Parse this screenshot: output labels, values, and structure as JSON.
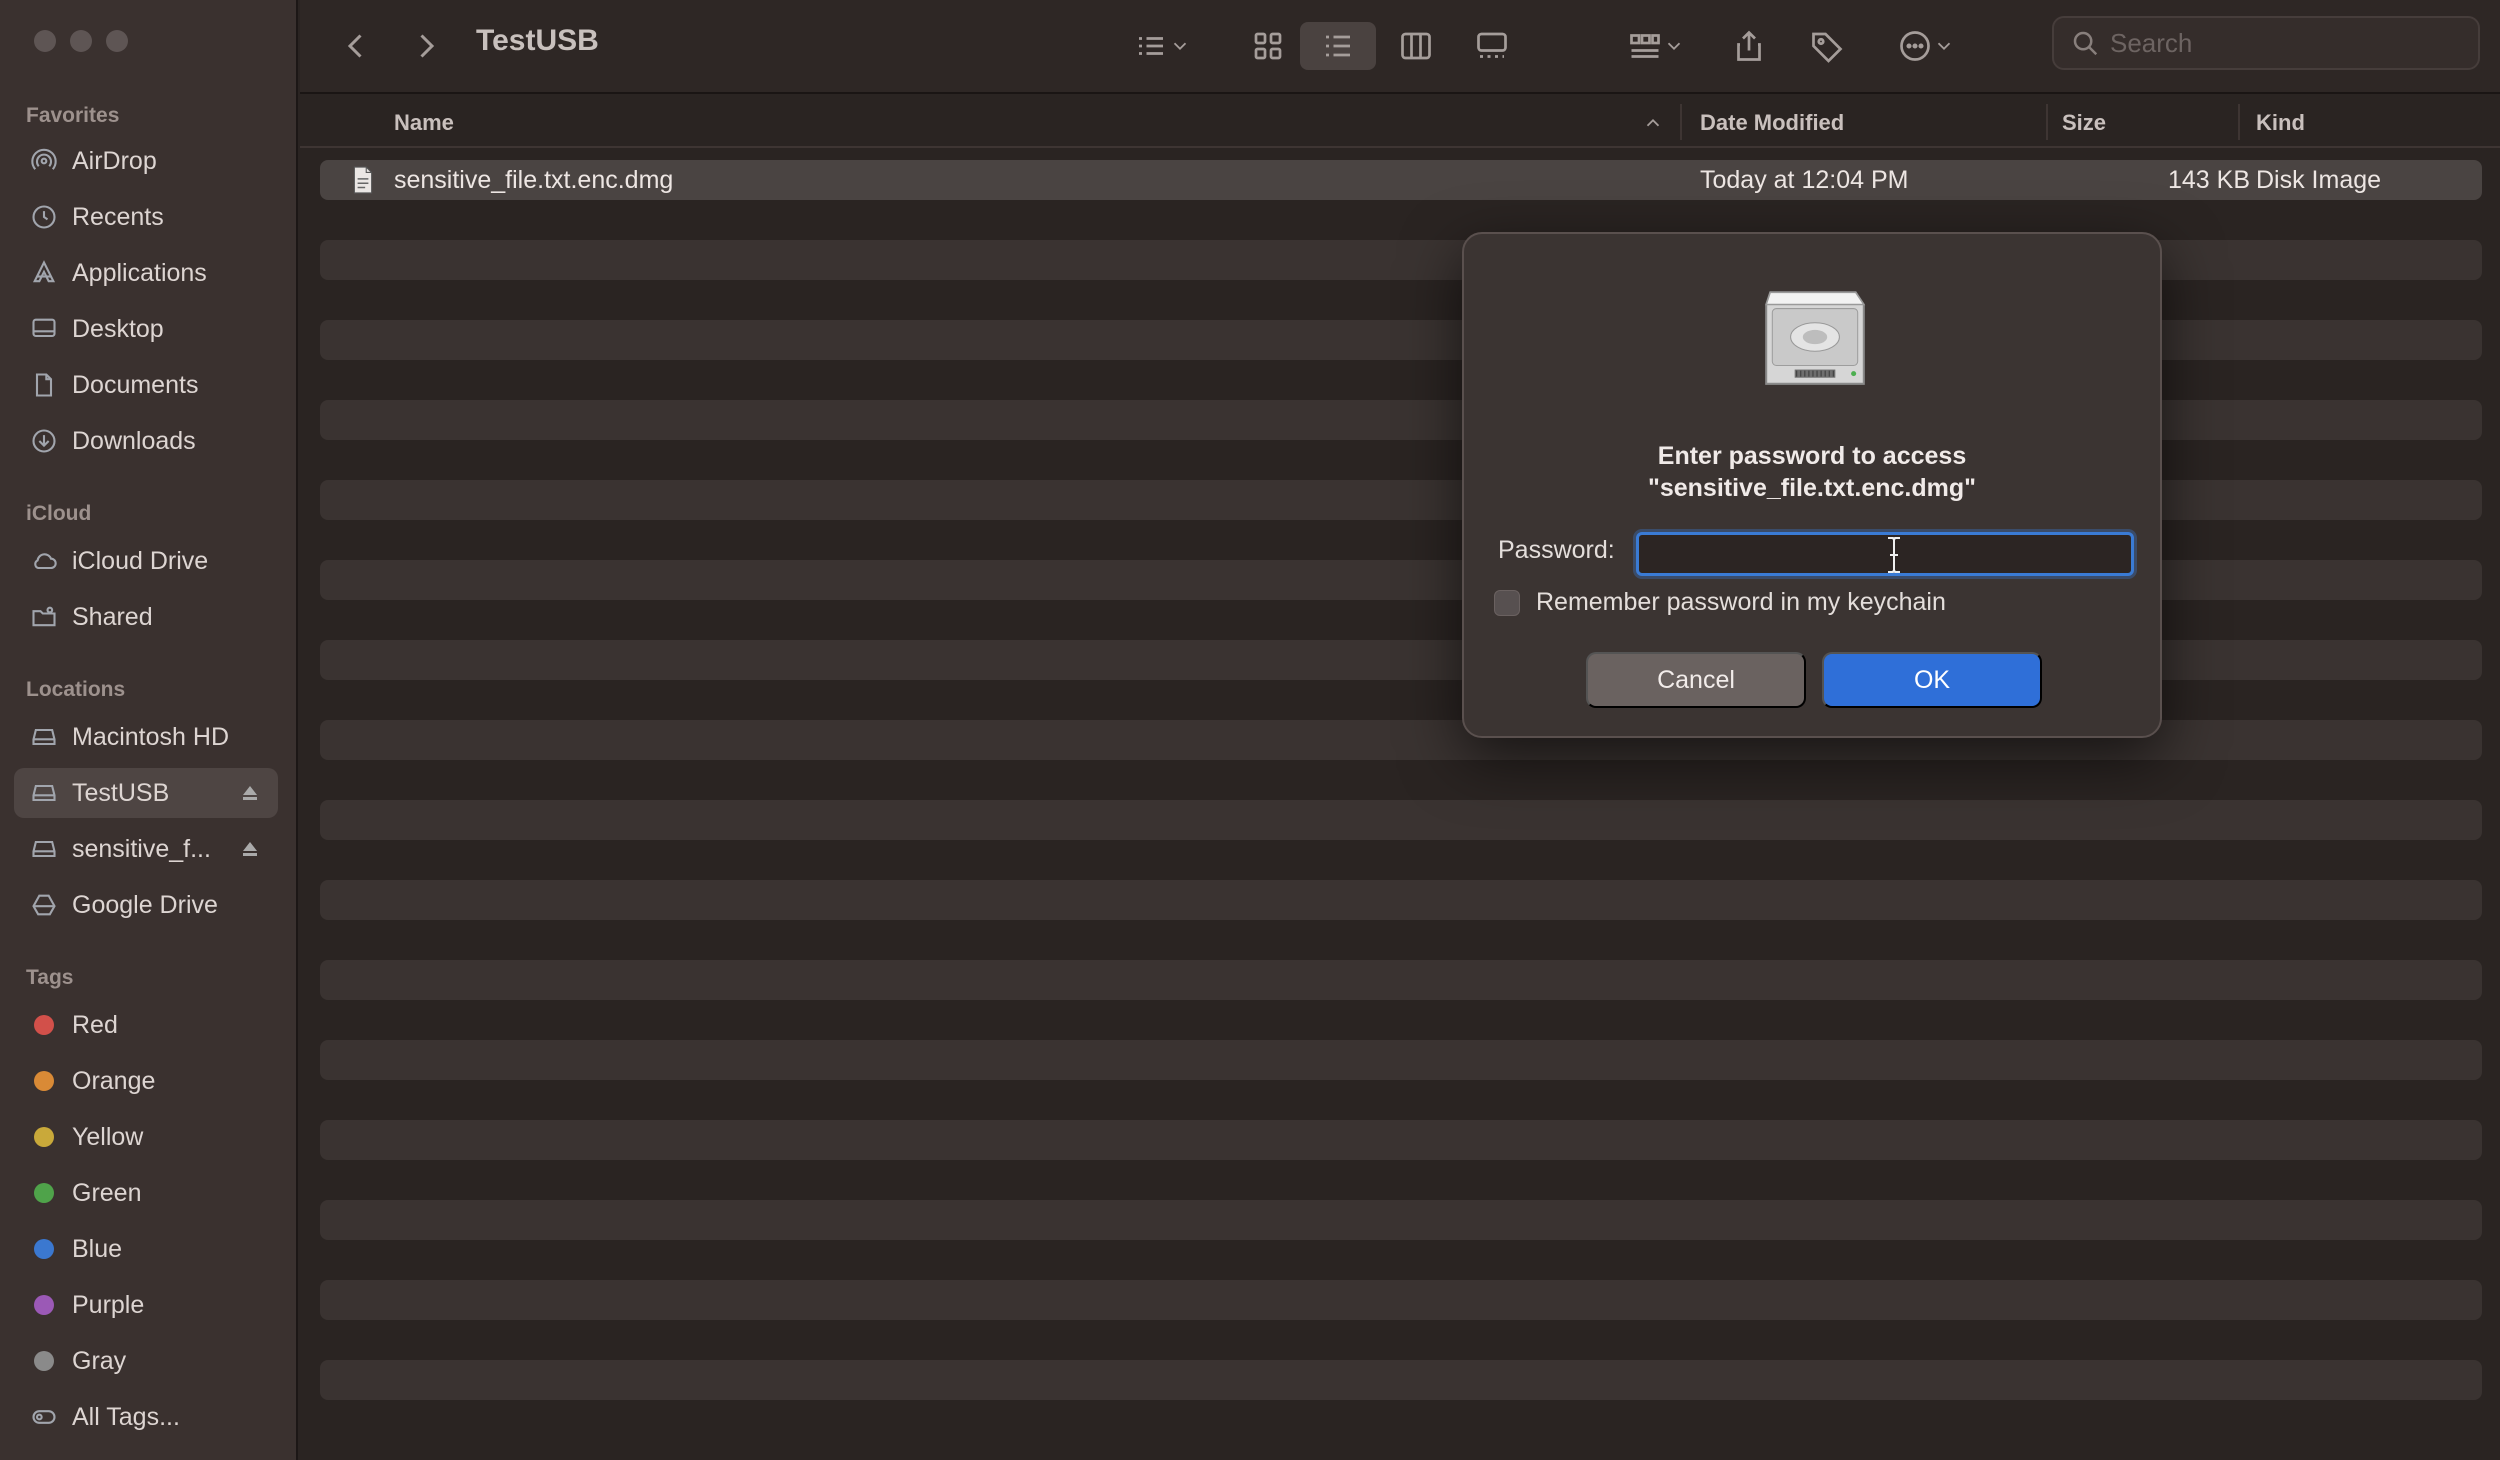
{
  "window": {
    "title": "TestUSB"
  },
  "sidebar": {
    "sections": [
      {
        "label": "Favorites",
        "items": [
          {
            "label": "AirDrop",
            "icon": "airdrop-icon"
          },
          {
            "label": "Recents",
            "icon": "clock-icon"
          },
          {
            "label": "Applications",
            "icon": "applications-icon"
          },
          {
            "label": "Desktop",
            "icon": "desktop-icon"
          },
          {
            "label": "Documents",
            "icon": "document-icon"
          },
          {
            "label": "Downloads",
            "icon": "download-icon"
          }
        ]
      },
      {
        "label": "iCloud",
        "items": [
          {
            "label": "iCloud Drive",
            "icon": "cloud-icon"
          },
          {
            "label": "Shared",
            "icon": "shared-folder-icon"
          }
        ]
      },
      {
        "label": "Locations",
        "items": [
          {
            "label": "Macintosh HD",
            "icon": "drive-icon"
          },
          {
            "label": "TestUSB",
            "icon": "drive-icon",
            "selected": true
          },
          {
            "label": "sensitive_f...",
            "icon": "drive-icon"
          },
          {
            "label": "Google Drive",
            "icon": "google-drive-icon"
          }
        ]
      },
      {
        "label": "Tags",
        "items": [
          {
            "label": "Red",
            "color": "#d2504a"
          },
          {
            "label": "Orange",
            "color": "#d98a36"
          },
          {
            "label": "Yellow",
            "color": "#c9a93a"
          },
          {
            "label": "Green",
            "color": "#4fa34a"
          },
          {
            "label": "Blue",
            "color": "#3b78d0"
          },
          {
            "label": "Purple",
            "color": "#9b59b6"
          },
          {
            "label": "Gray",
            "color": "#8a8a8a"
          },
          {
            "label": "All Tags...",
            "icon": "all-tags-icon"
          }
        ]
      }
    ]
  },
  "toolbar": {
    "title": "TestUSB",
    "search_placeholder": "Search"
  },
  "columns": {
    "name": "Name",
    "date": "Date Modified",
    "size": "Size",
    "kind": "Kind"
  },
  "files": [
    {
      "name": "sensitive_file.txt.enc.dmg",
      "date": "Today at 12:04 PM",
      "size": "143 KB",
      "kind": "Disk Image"
    }
  ],
  "dialog": {
    "title_line1": "Enter password to access",
    "title_line2": "\"sensitive_file.txt.enc.dmg\"",
    "password_label": "Password:",
    "password_value": "",
    "remember_label": "Remember password in my keychain",
    "remember_checked": false,
    "cancel_label": "Cancel",
    "ok_label": "OK"
  },
  "colors": {
    "accent": "#2f6fd8",
    "background": "#2a2422",
    "sidebar": "#3a312f"
  }
}
